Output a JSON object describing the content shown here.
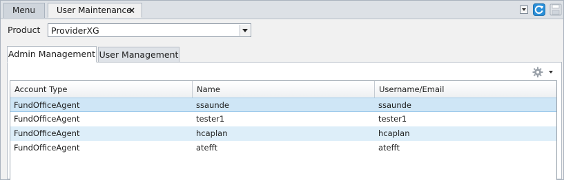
{
  "tabs": {
    "menu_label": "Menu",
    "active_label": "User Maintenance",
    "close_glyph": "×"
  },
  "toolbar": {
    "dropdown_icon": "dropdown-arrow-icon",
    "refresh_icon": "refresh-icon",
    "save_icon": "save-disk-icon"
  },
  "product": {
    "label": "Product",
    "value": "ProviderXG"
  },
  "inner_tabs": {
    "admin": "Admin Management",
    "user": "User Management"
  },
  "grid": {
    "columns": [
      "Account Type",
      "Name",
      "Username/Email"
    ],
    "rows": [
      [
        "FundOfficeAgent",
        "ssaunde",
        "ssaunde"
      ],
      [
        "FundOfficeAgent",
        "tester1",
        "tester1"
      ],
      [
        "FundOfficeAgent",
        "hcaplan",
        "hcaplan"
      ],
      [
        "FundOfficeAgent",
        "atefft",
        "atefft"
      ]
    ]
  },
  "colors": {
    "accent_blue": "#2a8fd8",
    "selected_row": "#cfe6f6",
    "alt_row": "#ddeef9"
  }
}
